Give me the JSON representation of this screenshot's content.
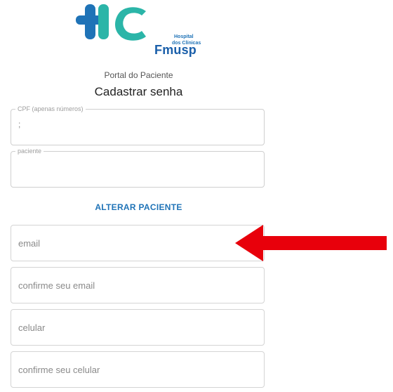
{
  "logo": {
    "line1": "Hospital",
    "line2": "dos Clínicas",
    "line3": "Fmusp",
    "colors": {
      "blue": "#1f73b7",
      "teal": "#2bb5a8",
      "dark_blue": "#1a5faa"
    }
  },
  "header": {
    "portal_label": "Portal do Paciente",
    "title": "Cadastrar senha"
  },
  "cpf_field": {
    "label": "CPF (apenas números)",
    "value": ";"
  },
  "patient_field": {
    "label": "paciente",
    "value": ""
  },
  "alter_patient_label": "ALTERAR PACIENTE",
  "inputs": {
    "email": {
      "placeholder": "email"
    },
    "confirm_email": {
      "placeholder": "confirme seu email"
    },
    "phone": {
      "placeholder": "celular"
    },
    "confirm_phone": {
      "placeholder": "confirme seu celular"
    }
  },
  "annotation": {
    "arrow_color": "#e8000b"
  }
}
